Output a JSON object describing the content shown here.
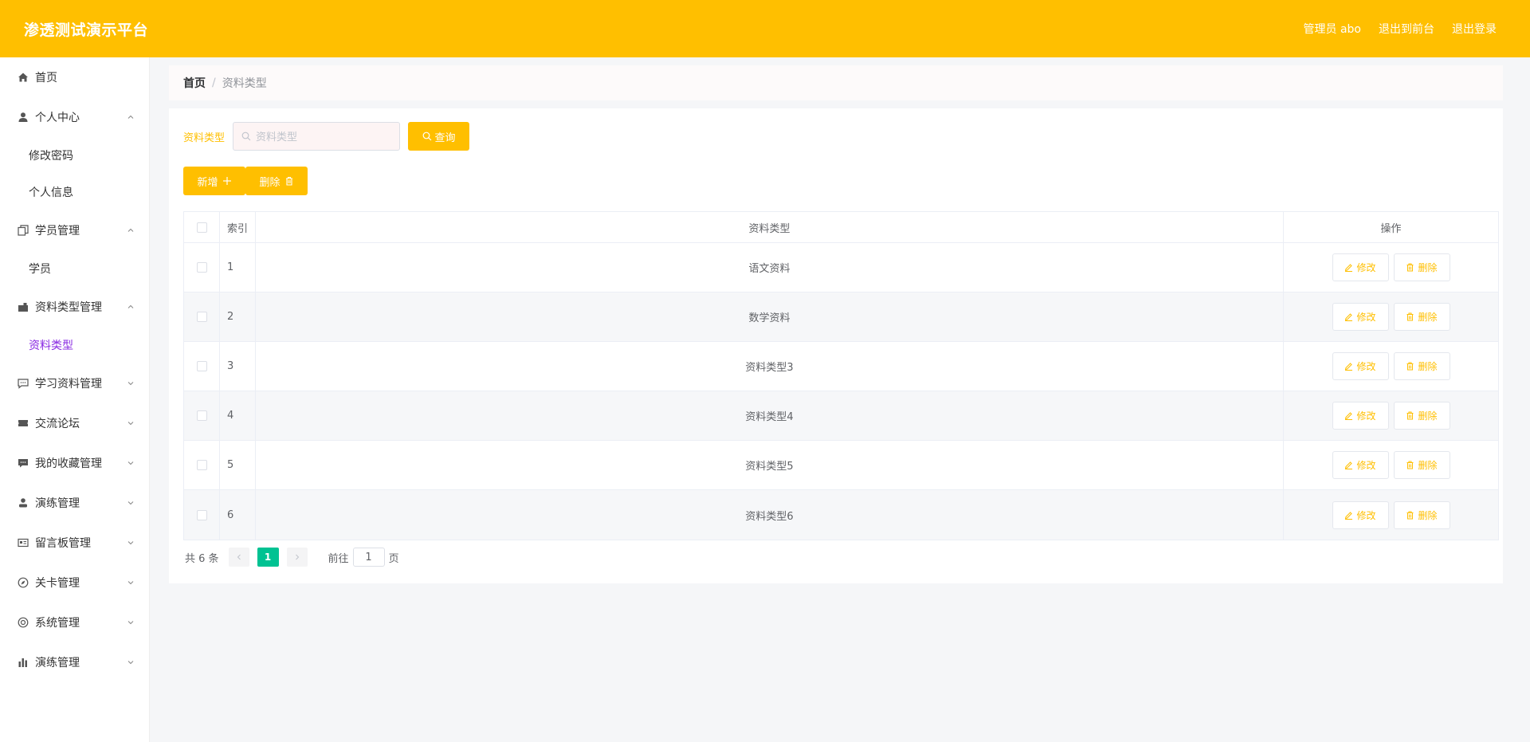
{
  "header": {
    "title": "渗透测试演示平台",
    "user_label": "管理员 abo",
    "to_front_label": "退出到前台",
    "logout_label": "退出登录"
  },
  "sidebar": {
    "items": [
      {
        "label": "首页",
        "icon": "home-icon",
        "expandable": false
      },
      {
        "label": "个人中心",
        "icon": "user-icon",
        "expandable": true,
        "expanded": true,
        "children": [
          "修改密码",
          "个人信息"
        ]
      },
      {
        "label": "学员管理",
        "icon": "copy-icon",
        "expandable": true,
        "expanded": true,
        "children": [
          "学员"
        ]
      },
      {
        "label": "资料类型管理",
        "icon": "briefcase-icon",
        "expandable": true,
        "expanded": true,
        "children": [
          "资料类型"
        ]
      },
      {
        "label": "学习资料管理",
        "icon": "chat-icon",
        "expandable": true,
        "expanded": false
      },
      {
        "label": "交流论坛",
        "icon": "ticket-icon",
        "expandable": true,
        "expanded": false
      },
      {
        "label": "我的收藏管理",
        "icon": "message-icon",
        "expandable": true,
        "expanded": false
      },
      {
        "label": "演练管理",
        "icon": "person-icon",
        "expandable": true,
        "expanded": false
      },
      {
        "label": "留言板管理",
        "icon": "postcard-icon",
        "expandable": true,
        "expanded": false
      },
      {
        "label": "关卡管理",
        "icon": "compass-icon",
        "expandable": true,
        "expanded": false
      },
      {
        "label": "系统管理",
        "icon": "setting-icon",
        "expandable": true,
        "expanded": false
      },
      {
        "label": "演练管理",
        "icon": "chart-icon",
        "expandable": true,
        "expanded": false
      }
    ]
  },
  "breadcrumb": {
    "home": "首页",
    "separator": "/",
    "current": "资料类型"
  },
  "search": {
    "label": "资料类型",
    "placeholder": "资料类型",
    "button_label": "查询"
  },
  "actions": {
    "add_label": "新增",
    "delete_label": "删除"
  },
  "table": {
    "columns": {
      "index": "索引",
      "type": "资料类型",
      "ops": "操作"
    },
    "rows": [
      {
        "index": "1",
        "type": "语文资料"
      },
      {
        "index": "2",
        "type": "数学资料"
      },
      {
        "index": "3",
        "type": "资料类型3"
      },
      {
        "index": "4",
        "type": "资料类型4"
      },
      {
        "index": "5",
        "type": "资料类型5"
      },
      {
        "index": "6",
        "type": "资料类型6"
      }
    ],
    "edit_label": "修改",
    "delete_label": "删除"
  },
  "pagination": {
    "total": "共 6 条",
    "current_page": "1",
    "goto_prefix": "前往",
    "goto_value": "1",
    "goto_suffix": "页"
  },
  "colors": {
    "accent": "#ffbf00",
    "active_menu": "#8a2be2",
    "page_active": "#00c292"
  }
}
